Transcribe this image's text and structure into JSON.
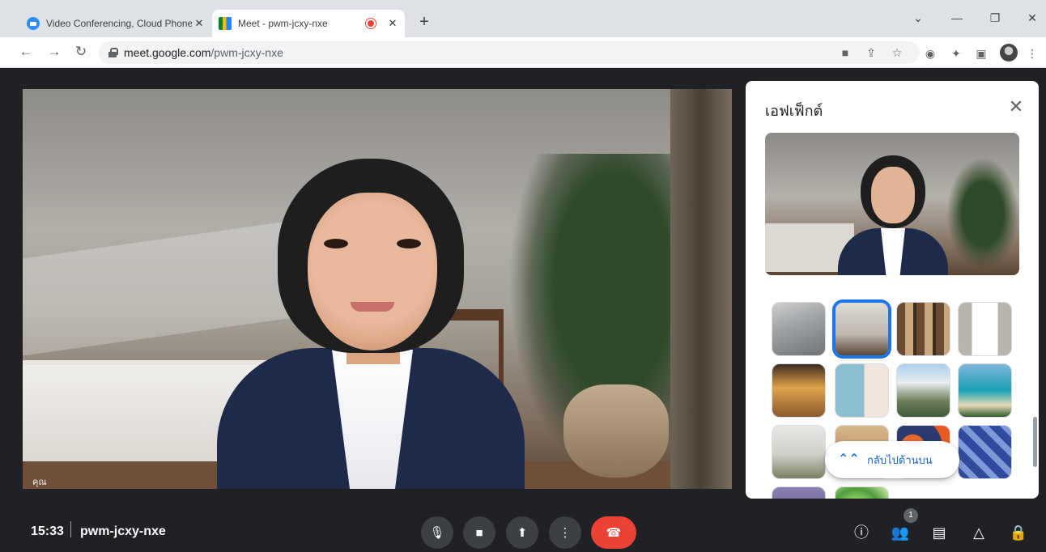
{
  "browser": {
    "tabs": [
      {
        "title": "Video Conferencing, Cloud Phone",
        "close": "✕"
      },
      {
        "title": "Meet - pwm-jcxy-nxe",
        "close": "✕"
      }
    ],
    "new_tab": "+",
    "window_controls": {
      "tab_search": "⌄",
      "minimize": "—",
      "restore": "❐",
      "close": "✕"
    },
    "nav": {
      "back": "←",
      "forward": "→",
      "reload": "↻"
    },
    "url_host": "meet.google.com",
    "url_path": "/pwm-jcxy-nxe",
    "omnibox_icons": {
      "camera": "■",
      "share": "⇪",
      "bookmark": "☆"
    },
    "extension_icons": {
      "screenshot": "◉",
      "extensions": "✦",
      "side_panel": "▣",
      "menu": "⋮"
    }
  },
  "video": {
    "self_label": "คุณ"
  },
  "effects_panel": {
    "title": "เอฟเฟ็กต์",
    "close": "✕",
    "back_to_top_label": "กลับไปด้านบน",
    "back_to_top_icon": "⌃⌃",
    "selected_index": 1
  },
  "meeting": {
    "time": "15:33",
    "code": "pwm-jcxy-nxe",
    "participants_count": "1",
    "controls": {
      "mic": "🎙",
      "camera": "■",
      "present": "⬆",
      "more": "⋮",
      "end_call": "☎"
    },
    "right_controls": {
      "info": "ⓘ",
      "people": "👥",
      "chat": "▤",
      "activities": "△",
      "host_controls": "🔒"
    }
  },
  "colors": {
    "accent": "#1a73e8",
    "end_call": "#ea4335",
    "bar_bg": "#202124",
    "recording": "#ea4335"
  }
}
